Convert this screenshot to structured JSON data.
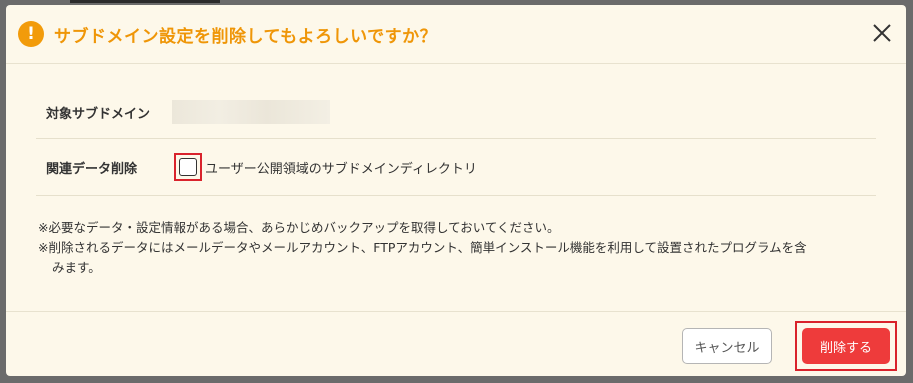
{
  "dialog": {
    "title": "サブドメイン設定を削除してもよろしいですか？",
    "warn_icon_glyph": "!",
    "icons": {
      "warning": "warning-icon",
      "close": "close-icon"
    },
    "accent_color": "#f29b0a",
    "danger_color": "#ee3b3b"
  },
  "fields": {
    "target_label": "対象サブドメイン",
    "related_label": "関連データ削除",
    "related_option": "ユーザー公開領域のサブドメインディレクトリ",
    "related_checked": false
  },
  "notes": {
    "line1": "※必要なデータ・設定情報がある場合、あらかじめバックアップを取得しておいてください。",
    "line2": "※削除されるデータにはメールデータやメールアカウント、FTPアカウント、簡単インストール機能を利用して設置されたプログラムを含",
    "line3": "みます。"
  },
  "buttons": {
    "cancel": "キャンセル",
    "delete": "削除する"
  }
}
